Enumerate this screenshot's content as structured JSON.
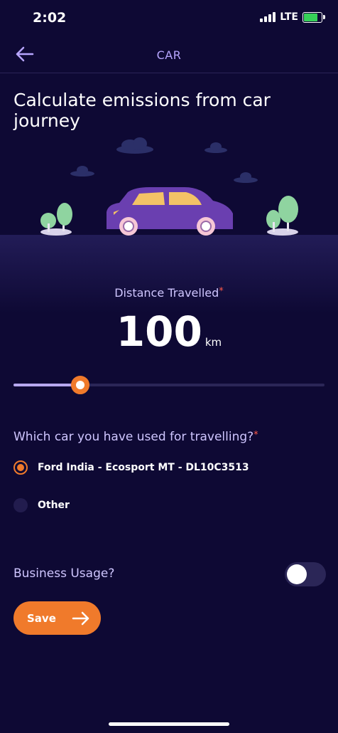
{
  "status_bar": {
    "time": "2:02",
    "network": "LTE"
  },
  "nav": {
    "title": "CAR",
    "back_icon": "arrow-left-icon"
  },
  "heading": "Calculate emissions from car journey",
  "distance": {
    "label": "Distance Travelled",
    "required_mark": "*",
    "value": "100",
    "unit": "km",
    "slider_fraction": 0.21
  },
  "car_question": {
    "label": "Which car you have used for travelling?",
    "required_mark": "*",
    "options": [
      {
        "label": "Ford India - Ecosport MT - DL10C3513",
        "selected": true
      },
      {
        "label": "Other",
        "selected": false
      }
    ]
  },
  "business": {
    "label": "Business Usage?",
    "enabled": false
  },
  "save_label": "Save",
  "colors": {
    "background": "#0e0934",
    "accent": "#f07a2b",
    "label": "#cfc6ff",
    "nav_title": "#b7a5ff",
    "car_body": "#6a3fb0"
  }
}
